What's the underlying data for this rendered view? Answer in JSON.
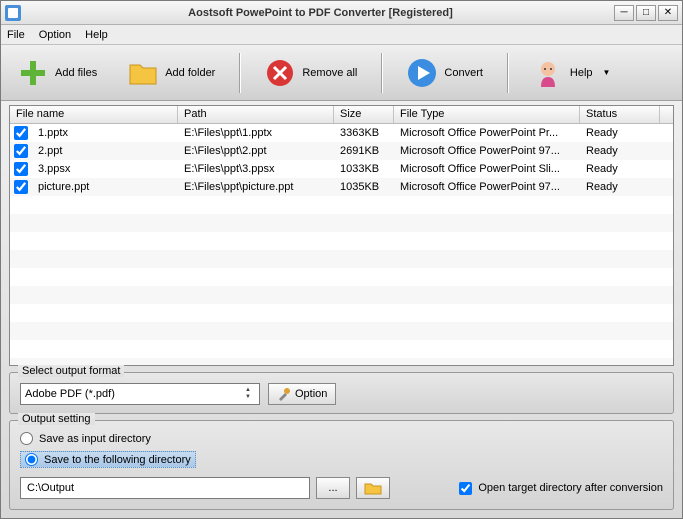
{
  "title": "Aostsoft PowePoint to PDF Converter [Registered]",
  "menu": {
    "file": "File",
    "option": "Option",
    "help": "Help"
  },
  "toolbar": {
    "add_files": "Add files",
    "add_folder": "Add folder",
    "remove_all": "Remove all",
    "convert": "Convert",
    "help": "Help"
  },
  "columns": {
    "name": "File name",
    "path": "Path",
    "size": "Size",
    "type": "File Type",
    "status": "Status"
  },
  "rows": [
    {
      "checked": true,
      "name": "1.pptx",
      "path": "E:\\Files\\ppt\\1.pptx",
      "size": "3363KB",
      "type": "Microsoft Office PowerPoint Pr...",
      "status": "Ready"
    },
    {
      "checked": true,
      "name": "2.ppt",
      "path": "E:\\Files\\ppt\\2.ppt",
      "size": "2691KB",
      "type": "Microsoft Office PowerPoint 97...",
      "status": "Ready"
    },
    {
      "checked": true,
      "name": "3.ppsx",
      "path": "E:\\Files\\ppt\\3.ppsx",
      "size": "1033KB",
      "type": "Microsoft Office PowerPoint Sli...",
      "status": "Ready"
    },
    {
      "checked": true,
      "name": "picture.ppt",
      "path": "E:\\Files\\ppt\\picture.ppt",
      "size": "1035KB",
      "type": "Microsoft Office PowerPoint 97...",
      "status": "Ready"
    }
  ],
  "format": {
    "legend": "Select output format",
    "selected": "Adobe PDF (*.pdf)",
    "option_btn": "Option"
  },
  "output": {
    "legend": "Output setting",
    "save_as_input": "Save as input directory",
    "save_following": "Save to the following directory",
    "path": "C:\\Output",
    "browse": "...",
    "open_after": "Open target directory after conversion"
  }
}
